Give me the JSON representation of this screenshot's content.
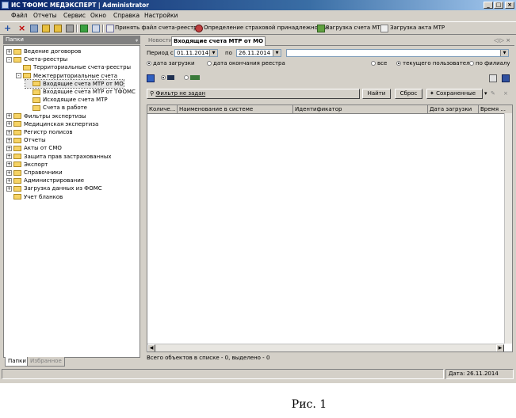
{
  "window": {
    "title": "ИС ТФОМС МЕДЭКСПЕРТ | Administrator"
  },
  "menu": [
    "Файл",
    "Отчеты",
    "Сервис",
    "Окно",
    "Справка",
    "Настройки"
  ],
  "toolbar": {
    "accept_file": "Принять файл счета-реестра",
    "insurance": "Определение страховой принадлежности",
    "load_mtr": "Загрузка счета МТР",
    "load_act": "Загрузка акта МТР"
  },
  "left_panel": {
    "header": "Папки",
    "tree": [
      {
        "label": "Ведение договоров",
        "level": 0,
        "expander": "+"
      },
      {
        "label": "Счета-реестры",
        "level": 0,
        "expander": "-"
      },
      {
        "label": "Территориальные счета-реестры",
        "level": 1,
        "expander": ""
      },
      {
        "label": "Межтерриториальные счета",
        "level": 1,
        "expander": "-"
      },
      {
        "label": "Входящие счета МТР от МО",
        "level": 2,
        "expander": "",
        "selected": true
      },
      {
        "label": "Входящие счета МТР от ТФОМС",
        "level": 2,
        "expander": ""
      },
      {
        "label": "Исходящие счета МТР",
        "level": 2,
        "expander": ""
      },
      {
        "label": "Счета в работе",
        "level": 2,
        "expander": ""
      },
      {
        "label": "Фильтры экспертизы",
        "level": 0,
        "expander": "+"
      },
      {
        "label": "Медицинская экспертиза",
        "level": 0,
        "expander": "+"
      },
      {
        "label": "Регистр полисов",
        "level": 0,
        "expander": "+"
      },
      {
        "label": "Отчеты",
        "level": 0,
        "expander": "+"
      },
      {
        "label": "Акты от СМО",
        "level": 0,
        "expander": "+"
      },
      {
        "label": "Защита прав застрахованных",
        "level": 0,
        "expander": "+"
      },
      {
        "label": "Экспорт",
        "level": 0,
        "expander": "+"
      },
      {
        "label": "Справочники",
        "level": 0,
        "expander": "+"
      },
      {
        "label": "Администрирование",
        "level": 0,
        "expander": "+"
      },
      {
        "label": "Загрузка данных из ФОМС",
        "level": 0,
        "expander": "+"
      },
      {
        "label": "Учет бланков",
        "level": 0,
        "expander": ""
      }
    ],
    "tabs": [
      "Папки",
      "Избранное"
    ]
  },
  "content": {
    "tabs": [
      "Новости",
      "Входящие счета МТР от МО"
    ],
    "period_label": "Период с",
    "date_from": "01.11.2014",
    "to_label": "по",
    "date_to": "26.11.2014",
    "search_value": "",
    "date_mode": [
      "дата загрузки",
      "дата окончания реестра"
    ],
    "scope": [
      "все",
      "текущего пользователя",
      "по филиалу"
    ],
    "filter_link": "Фильтр не задан",
    "find_button": "Найти",
    "reset_button": "Сброс",
    "saved_button": "Сохраненные",
    "columns": [
      "Количе...",
      "Наименование в системе",
      "Идентификатор",
      "Дата загрузки",
      "Время ..."
    ],
    "rows": [],
    "status_line": "Всего объектов в списке - 0, выделено - 0"
  },
  "statusbar": {
    "date": "Дата: 26.11.2014"
  },
  "caption": "Рис. 1"
}
